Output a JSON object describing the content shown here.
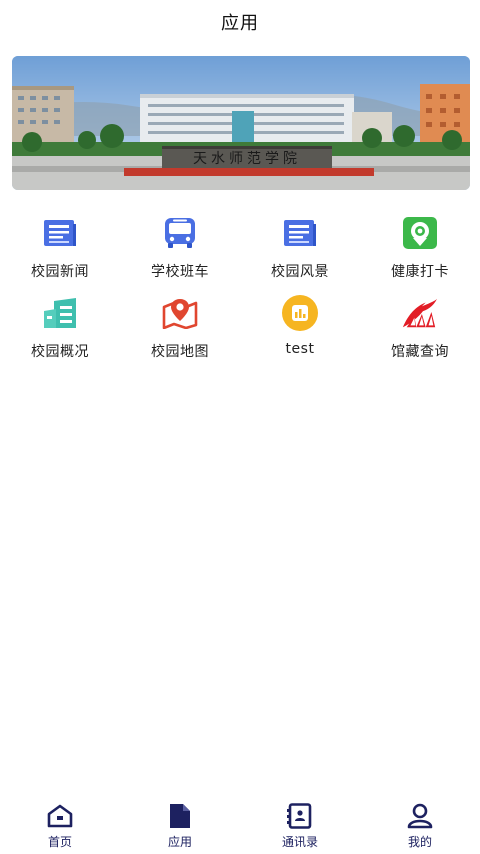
{
  "header": {
    "title": "应用"
  },
  "banner": {
    "sign_text": "天水师范学院"
  },
  "apps": [
    {
      "label": "校园新闻",
      "icon": "news-icon",
      "color": "#4a6fe3"
    },
    {
      "label": "学校班车",
      "icon": "bus-icon",
      "color": "#4a6fe3"
    },
    {
      "label": "校园风景",
      "icon": "scenery-icon",
      "color": "#4a6fe3"
    },
    {
      "label": "健康打卡",
      "icon": "health-checkin-icon",
      "color": "#3cb84a"
    },
    {
      "label": "校园概况",
      "icon": "building-icon",
      "color": "#3fbfae"
    },
    {
      "label": "校园地图",
      "icon": "map-pin-icon",
      "color": "#e0462f"
    },
    {
      "label": "test",
      "icon": "chart-badge-icon",
      "color": "#f6b521"
    },
    {
      "label": "馆藏查询",
      "icon": "library-icon",
      "color": "#e21d26"
    }
  ],
  "tabbar": {
    "accent": "#1d2160",
    "items": [
      {
        "label": "首页",
        "icon": "home-icon"
      },
      {
        "label": "应用",
        "icon": "apps-doc-icon"
      },
      {
        "label": "通讯录",
        "icon": "contacts-icon"
      },
      {
        "label": "我的",
        "icon": "profile-icon"
      }
    ]
  }
}
